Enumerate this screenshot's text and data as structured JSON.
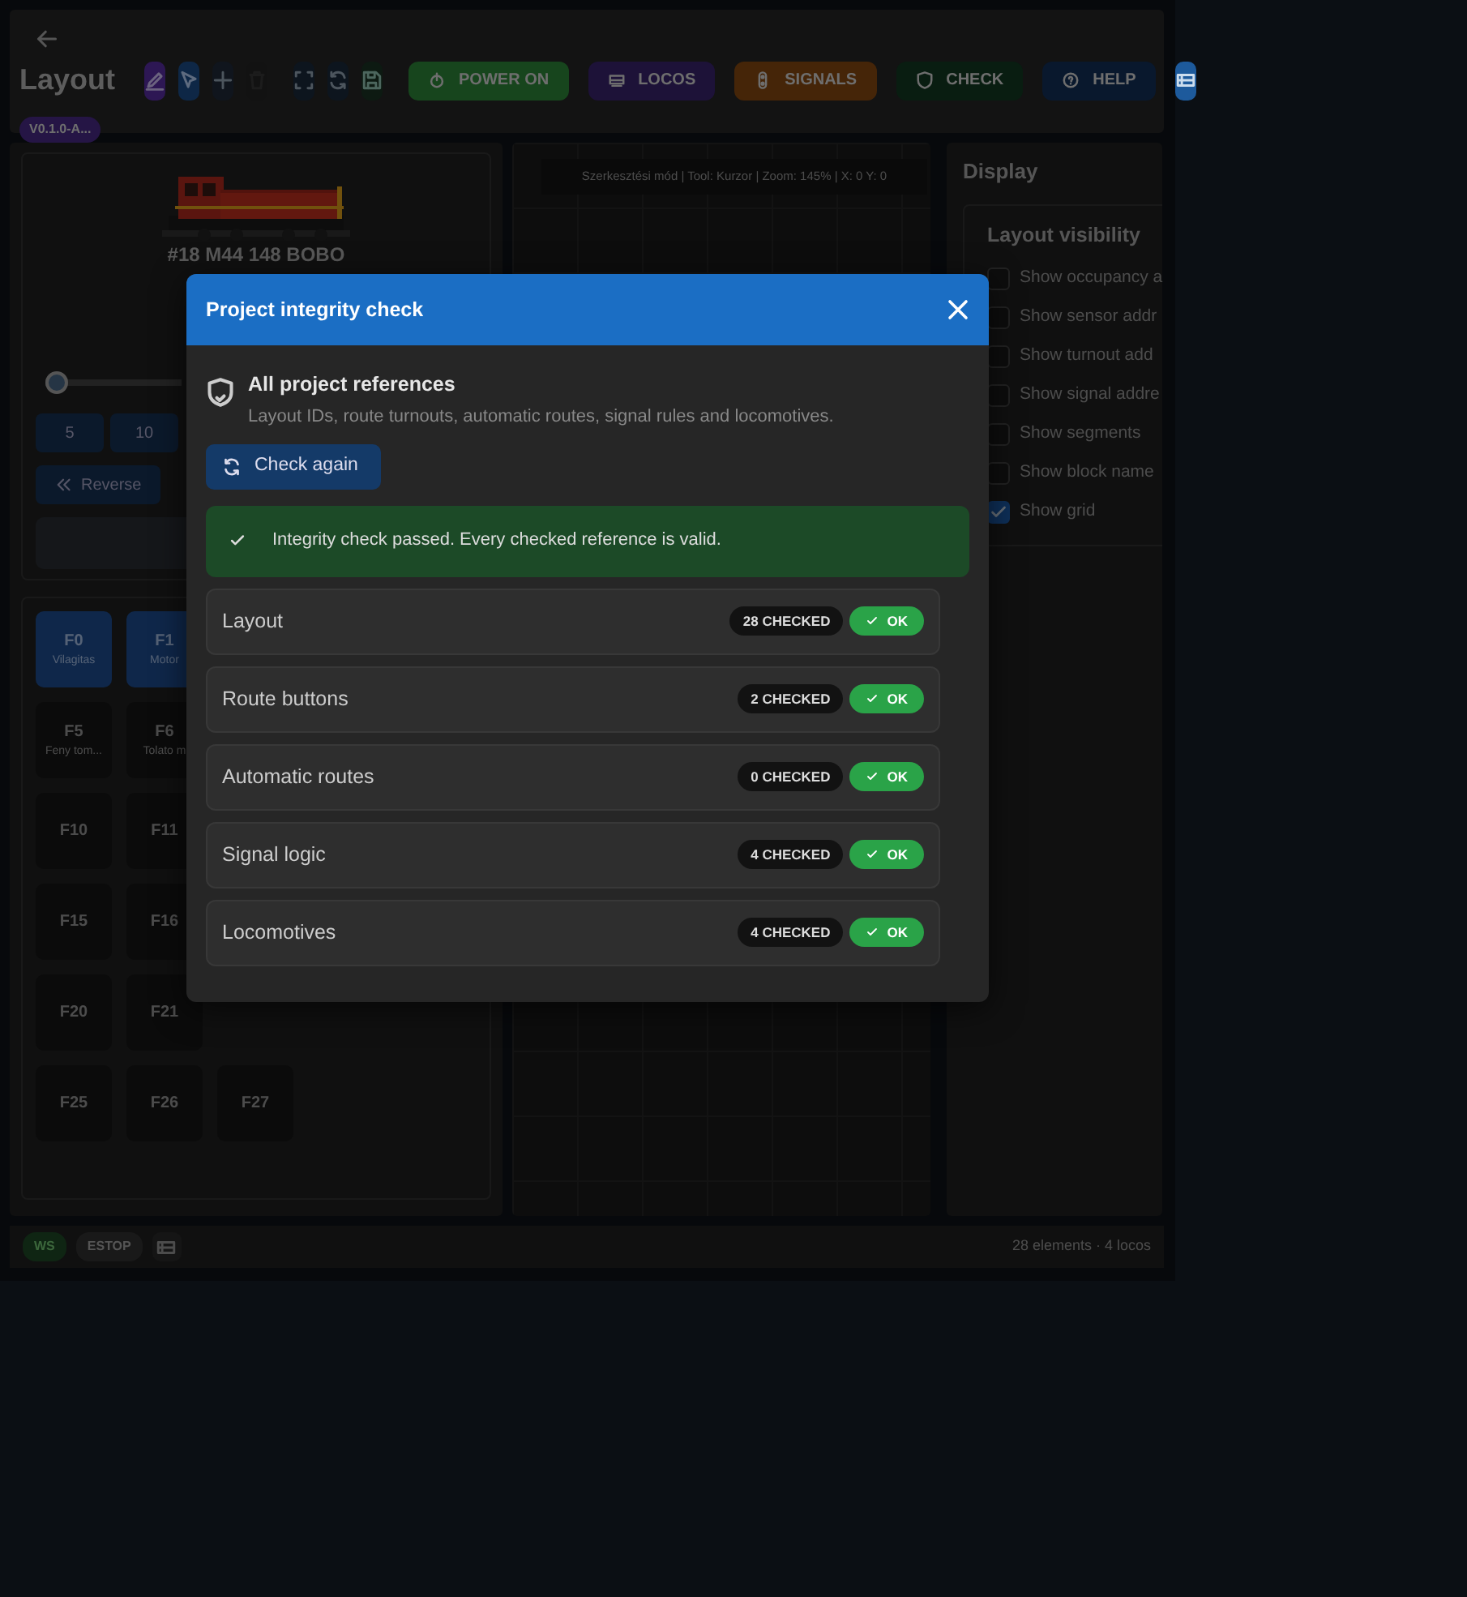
{
  "header": {
    "title": "Layout",
    "version": "V0.1.0-A...",
    "tools": [
      {
        "kind": "edit",
        "disabled": false
      },
      {
        "kind": "select",
        "disabled": false
      },
      {
        "kind": "add",
        "disabled": false
      },
      {
        "kind": "delete",
        "disabled": true
      },
      {
        "kind": "fit",
        "disabled": false
      },
      {
        "kind": "reload",
        "disabled": false
      },
      {
        "kind": "save",
        "disabled": false
      }
    ],
    "actions": [
      {
        "kind": "power",
        "label": "POWER ON"
      },
      {
        "kind": "locos",
        "label": "LOCOS"
      },
      {
        "kind": "signals",
        "label": "SIGNALS"
      },
      {
        "kind": "check",
        "label": "CHECK"
      },
      {
        "kind": "help",
        "label": "HELP"
      }
    ]
  },
  "throttle": {
    "name": "#18 M44 148 BOBO",
    "level": 0,
    "speeds": [
      "5",
      "10"
    ],
    "reverse": "Reverse"
  },
  "functions": [
    [
      {
        "key": "F0",
        "label": "Vilagitas",
        "on": true
      },
      {
        "key": "F1",
        "label": "Motor",
        "on": true
      }
    ],
    [
      {
        "key": "F5",
        "label": "Feny tom...",
        "on": false
      },
      {
        "key": "F6",
        "label": "Tolato m",
        "on": false
      }
    ],
    [
      {
        "key": "F10",
        "on": false
      },
      {
        "key": "F11",
        "on": false
      }
    ],
    [
      {
        "key": "F15",
        "on": false
      },
      {
        "key": "F16",
        "on": false
      }
    ],
    [
      {
        "key": "F20",
        "on": false
      },
      {
        "key": "F21",
        "on": false
      }
    ],
    [
      {
        "key": "F25",
        "on": false
      },
      {
        "key": "F26",
        "on": false
      },
      {
        "key": "F27",
        "on": false
      }
    ]
  ],
  "canvas": {
    "status": "Szerkesztési mód | Tool: Kurzor | Zoom: 145% | X: 0 Y: 0"
  },
  "display": {
    "title": "Display",
    "section": "Layout visibility",
    "options": [
      {
        "label": "Show occupancy a",
        "checked": false
      },
      {
        "label": "Show sensor addr",
        "checked": false
      },
      {
        "label": "Show turnout add",
        "checked": false
      },
      {
        "label": "Show signal addre",
        "checked": false
      },
      {
        "label": "Show segments",
        "checked": false
      },
      {
        "label": "Show block name",
        "checked": false
      },
      {
        "label": "Show grid",
        "checked": true
      }
    ]
  },
  "status_bar": {
    "ws": "WS",
    "estop": "ESTOP",
    "summary": "28 elements · 4 locos"
  },
  "modal": {
    "title": "Project integrity check",
    "scope_title": "All project references",
    "scope_text": "Layout IDs, route turnouts, automatic routes, signal rules and locomotives.",
    "button": "Check again",
    "alert": "Integrity check passed. Every checked reference is valid.",
    "checks": [
      {
        "name": "Layout",
        "count": "28 CHECKED",
        "status": "OK",
        "passed": true
      },
      {
        "name": "Route buttons",
        "count": "2 CHECKED",
        "status": "OK",
        "passed": true
      },
      {
        "name": "Automatic routes",
        "count": "0 CHECKED",
        "status": "OK",
        "passed": true
      },
      {
        "name": "Signal logic",
        "count": "4 CHECKED",
        "status": "OK",
        "passed": true
      },
      {
        "name": "Locomotives",
        "count": "4 CHECKED",
        "status": "OK",
        "passed": true
      }
    ]
  }
}
